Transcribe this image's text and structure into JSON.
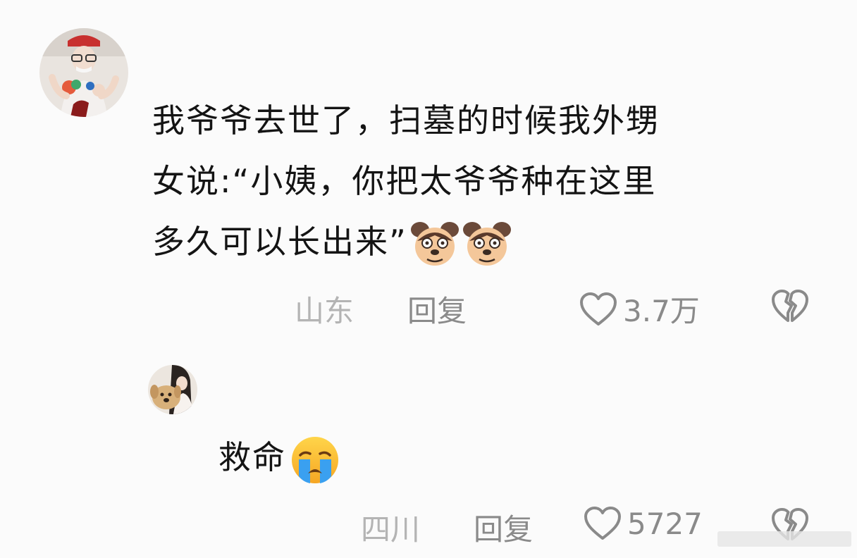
{
  "comments": [
    {
      "avatar_icon": "user-avatar-icon",
      "lines": [
        "我爷爷去世了，扫墓的时候我外甥",
        "女说:“小姨，你把太爷爷种在这里",
        "多久可以长出来”"
      ],
      "emojis": [
        "crying-dog-emoji",
        "crying-dog-emoji"
      ],
      "location": "山东",
      "reply_label": "回复",
      "likes": "3.7万"
    },
    {
      "avatar_icon": "user-avatar-with-dog-icon",
      "text": "救命",
      "emojis": [
        "loudly-crying-face-emoji"
      ],
      "location": "四川",
      "reply_label": "回复",
      "likes": "5727"
    }
  ],
  "colors": {
    "background": "#fbfbfb",
    "text": "#141414",
    "meta": "#8a8a8a",
    "location": "#b4b4b4"
  }
}
